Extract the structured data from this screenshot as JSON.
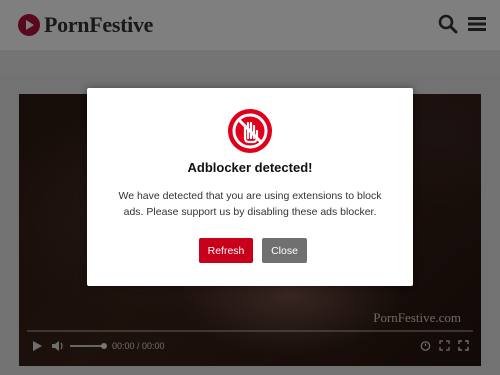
{
  "header": {
    "logo_text": "PornFestive",
    "icons": [
      "search-icon",
      "menu-icon"
    ]
  },
  "player": {
    "watermark": "PornFestive.com",
    "time": "00:00 / 00:00",
    "controls": [
      "play-icon",
      "volume-icon",
      "timer-icon",
      "pip-icon",
      "fullscreen-icon"
    ]
  },
  "modal": {
    "title": "Adblocker detected!",
    "message": "We have detected that you are using extensions to block ads. Please support us by disabling these ads blocker.",
    "refresh_label": "Refresh",
    "close_label": "Close",
    "accent": "#e0001b"
  }
}
